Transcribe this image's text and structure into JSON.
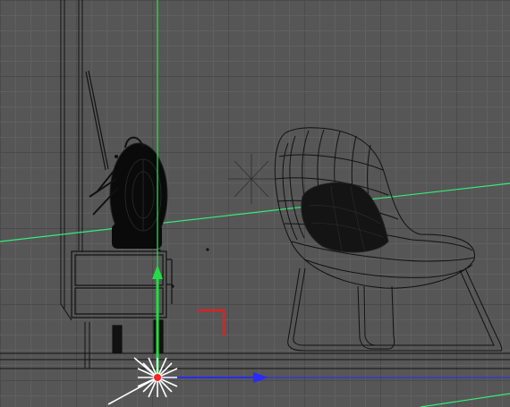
{
  "viewport": {
    "background": "#565656",
    "grid_color": "#606060",
    "grid_major_color": "#4a4a4a",
    "wire_color": "#000000",
    "axis_colors": {
      "x": "#2a2aff",
      "y": "#22dd44",
      "z": "#ff2222"
    },
    "horizon_color": "#33ee77",
    "light_gizmo_color": "#ffffff",
    "corner_marker_color": "#dd2222"
  },
  "scene": {
    "objects": [
      "fan",
      "nightstand",
      "lounge-chair",
      "chair-cushion",
      "floor-lamp",
      "wall-edge"
    ],
    "icons": [
      "translate-gizmo-icon",
      "light-gizmo-icon",
      "corner-marker-icon"
    ]
  }
}
